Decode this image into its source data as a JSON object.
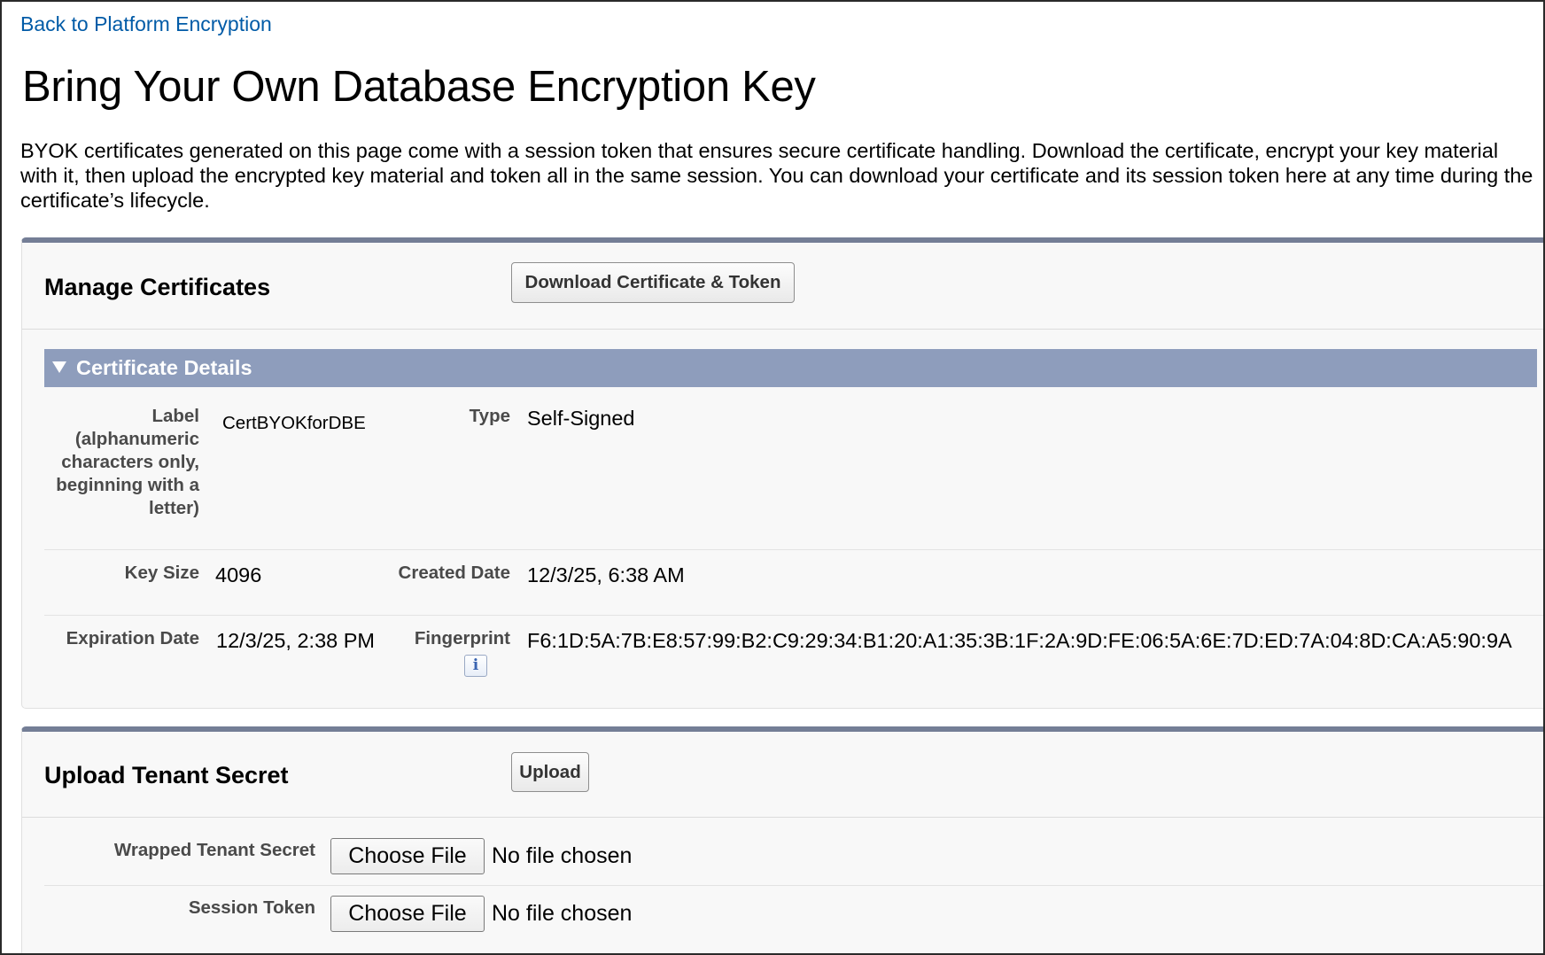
{
  "nav": {
    "back_link": "Back to Platform Encryption"
  },
  "page": {
    "title": "Bring Your Own Database Encryption Key",
    "intro": "BYOK certificates generated on this page come with a session token that ensures secure certificate handling. Download the certificate, encrypt your key material with it, then upload the encrypted key material and token all in the same session. You can download your certificate and its session token here at any time during the certificate’s lifecycle."
  },
  "manage": {
    "title": "Manage Certificates",
    "download_button": "Download Certificate & Token",
    "section_title": "Certificate Details",
    "fields": {
      "label_label": "Label (alphanumeric characters only, beginning with a letter)",
      "label_value": "CertBYOKforDBE",
      "type_label": "Type",
      "type_value": "Self-Signed",
      "key_size_label": "Key Size",
      "key_size_value": "4096",
      "created_label": "Created Date",
      "created_value": "12/3/25, 6:38 AM",
      "expiration_label": "Expiration Date",
      "expiration_value": "12/3/25, 2:38 PM",
      "fingerprint_label": "Fingerprint",
      "fingerprint_value": "F6:1D:5A:7B:E8:57:99:B2:C9:29:34:B1:20:A1:35:3B:1F:2A:9D:FE:06:5A:6E:7D:ED:7A:04:8D:CA:A5:90:9A",
      "info_icon_glyph": "i"
    }
  },
  "upload": {
    "title": "Upload Tenant Secret",
    "upload_button": "Upload",
    "wrapped_label": "Wrapped Tenant Secret",
    "session_label": "Session Token",
    "choose_file": "Choose File",
    "no_file": "No file chosen"
  },
  "colors": {
    "link": "#015ba7",
    "panel_border": "#747e96",
    "section_bar": "#8e9dbc"
  },
  "icons": {
    "section_toggle": "triangle-down-icon",
    "help": "info-icon"
  }
}
